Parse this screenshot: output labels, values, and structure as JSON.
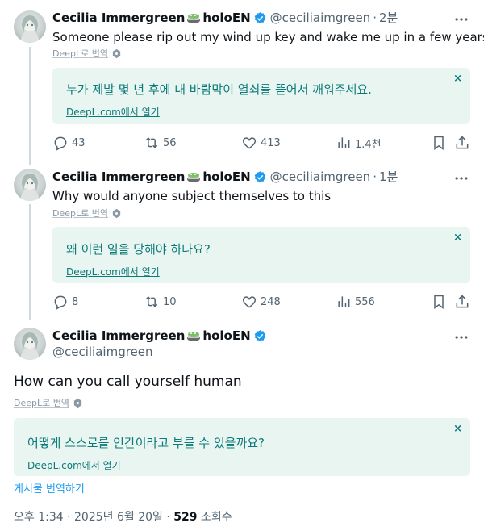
{
  "author": {
    "name": "Cecilia Immergreen",
    "name_suffix": "holoEN",
    "handle": "@ceciliaimgreen",
    "verified_color": "#1d9bf0"
  },
  "deepl_label": "DeepL로 번역",
  "deepl_link": "DeepL.com에서 열기",
  "close_glyph": "×",
  "dot": "·",
  "replies": [
    {
      "time": "2분",
      "text": "Someone please rip out my wind up key and wake me up in a few years",
      "translation": "누가 제발 몇 년 후에 내 바람막이 열쇠를 뜯어서 깨워주세요.",
      "stats": {
        "replies": "43",
        "reposts": "56",
        "likes": "413",
        "views": "1.4천"
      }
    },
    {
      "time": "1분",
      "text": "Why would anyone subject themselves to this",
      "translation": "왜 이런 일을 당해야 하나요?",
      "stats": {
        "replies": "8",
        "reposts": "10",
        "likes": "248",
        "views": "556"
      }
    }
  ],
  "main": {
    "text": "How can you call yourself human",
    "translation": "어떻게 스스로를 인간이라고 부를 수 있을까요?",
    "translate_post": "게시물 번역하기",
    "timestamp": "오후 1:34 · 2025년 6월 20일 · ",
    "views_count": "529",
    "views_label": " 조회수"
  }
}
